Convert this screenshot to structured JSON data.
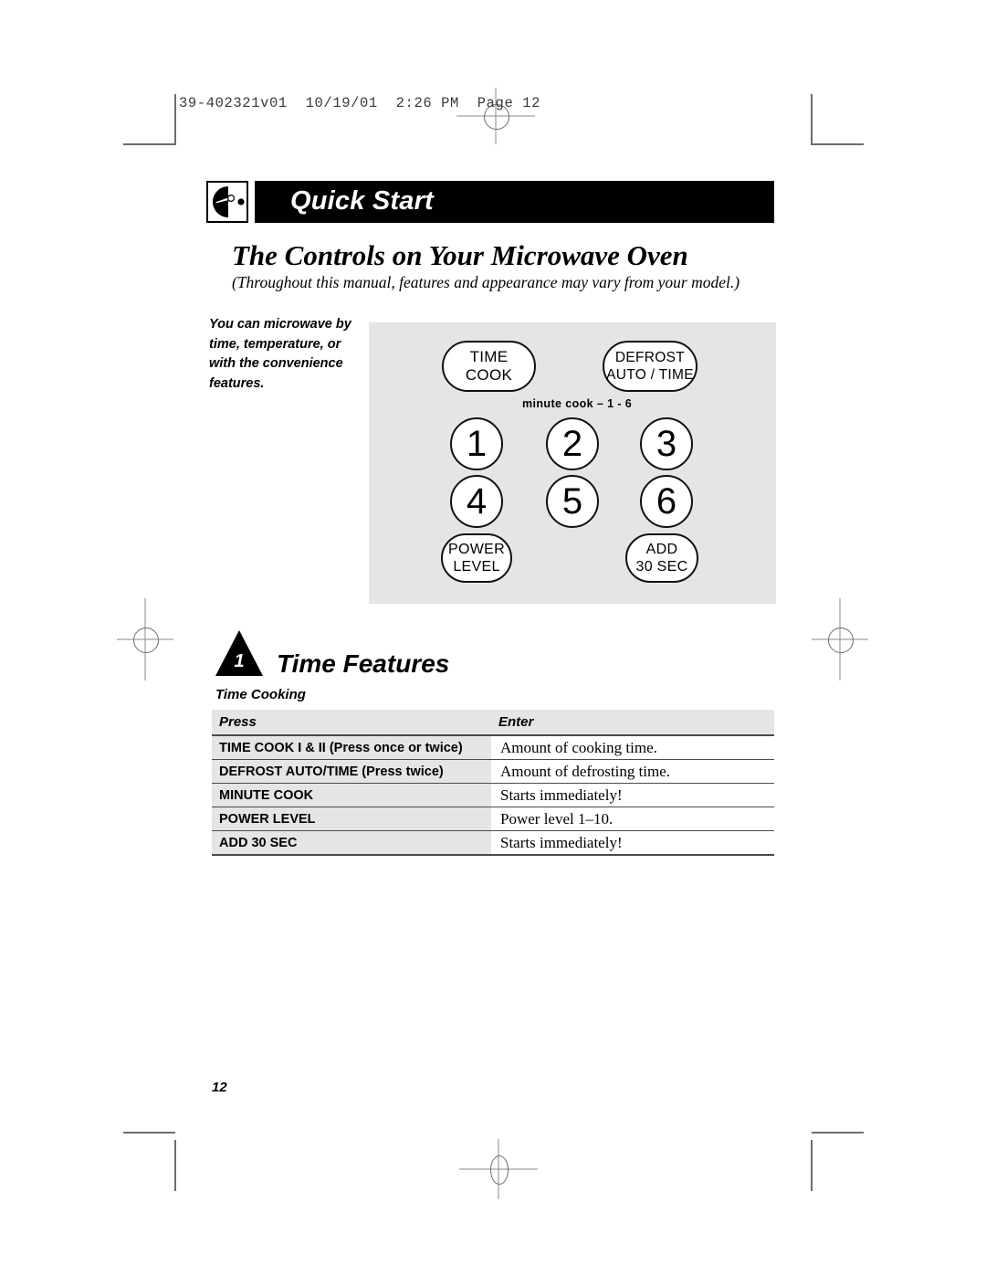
{
  "print_marks": {
    "slug_text": "39-402321v01  10/19/01  2:26 PM  Page 12"
  },
  "header": {
    "icon": "hand-dial-icon",
    "title": "Quick Start",
    "headline": "The Controls on Your Microwave Oven",
    "subhead": "(Throughout this manual, features and appearance may vary from your model.)"
  },
  "sidenote": {
    "text": "You can microwave by time, temperature, or with the convenience features."
  },
  "control_panel": {
    "background_color": "#e4e5e4",
    "minute_cook_label": "minute cook – 1 - 6",
    "buttons": [
      {
        "id": "time-cook",
        "shape": "pill",
        "lines": [
          "TIME",
          "COOK"
        ]
      },
      {
        "id": "defrost-auto-time",
        "shape": "pill",
        "lines": [
          "DEFROST",
          "AUTO / TIME"
        ]
      },
      {
        "id": "key-1",
        "shape": "circle",
        "lines": [
          "1"
        ]
      },
      {
        "id": "key-2",
        "shape": "circle",
        "lines": [
          "2"
        ]
      },
      {
        "id": "key-3",
        "shape": "circle",
        "lines": [
          "3"
        ]
      },
      {
        "id": "key-4",
        "shape": "circle",
        "lines": [
          "4"
        ]
      },
      {
        "id": "key-5",
        "shape": "circle",
        "lines": [
          "5"
        ]
      },
      {
        "id": "key-6",
        "shape": "circle",
        "lines": [
          "6"
        ]
      },
      {
        "id": "power-level",
        "shape": "pill",
        "lines": [
          "POWER",
          "LEVEL"
        ]
      },
      {
        "id": "add-30-sec",
        "shape": "pill",
        "lines": [
          "ADD",
          "30 SEC"
        ]
      }
    ],
    "button_labels": {
      "time_cook_1": "TIME",
      "time_cook_2": "COOK",
      "defrost_1": "DEFROST",
      "defrost_2": "AUTO / TIME",
      "key_1": "1",
      "key_2": "2",
      "key_3": "3",
      "key_4": "4",
      "key_5": "5",
      "key_6": "6",
      "power_level_1": "POWER",
      "power_level_2": "LEVEL",
      "add_30_sec_1": "ADD",
      "add_30_sec_2": "30 SEC"
    }
  },
  "section": {
    "number": "1",
    "title": "Time Features",
    "subsection": "Time Cooking"
  },
  "table": {
    "columns": [
      "Press",
      "Enter"
    ],
    "rows": [
      {
        "press": "TIME COOK I & II (Press once or twice)",
        "enter": "Amount of cooking time."
      },
      {
        "press": "DEFROST AUTO/TIME (Press twice)",
        "enter": "Amount of defrosting time."
      },
      {
        "press": "MINUTE COOK",
        "enter": "Starts immediately!"
      },
      {
        "press": "POWER LEVEL",
        "enter": "Power level 1–10."
      },
      {
        "press": "ADD 30 SEC",
        "enter": "Starts immediately!"
      }
    ]
  },
  "footer": {
    "page_number": "12"
  }
}
